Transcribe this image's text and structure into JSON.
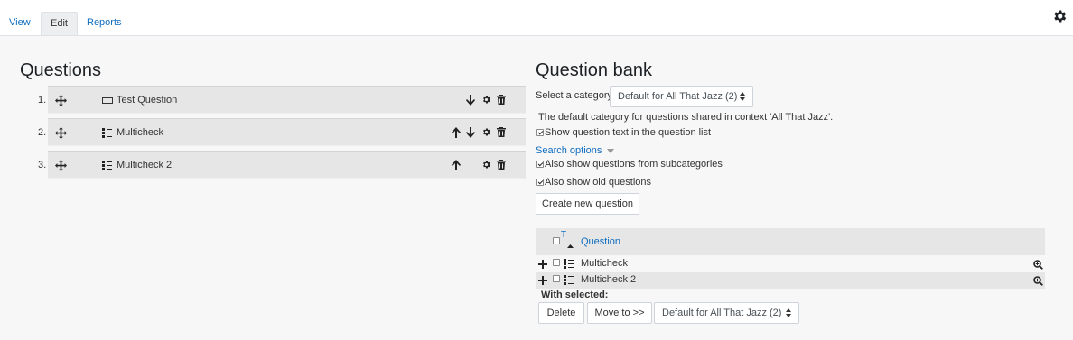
{
  "tabs": [
    {
      "label": "View"
    },
    {
      "label": "Edit"
    },
    {
      "label": "Reports"
    }
  ],
  "active_tab": "Edit",
  "questions": {
    "heading": "Questions",
    "items": [
      {
        "number": "1.",
        "name": "Test Question",
        "type_icon": "description-icon",
        "actions": [
          "arrow-down-icon",
          "gear-icon",
          "trash-icon"
        ]
      },
      {
        "number": "2.",
        "name": "Multicheck",
        "type_icon": "list-icon",
        "actions": [
          "arrow-up-icon",
          "arrow-down-icon",
          "gear-icon",
          "trash-icon"
        ]
      },
      {
        "number": "3.",
        "name": "Multicheck 2",
        "type_icon": "list-icon",
        "actions": [
          "arrow-up-icon",
          "gear-icon",
          "trash-icon"
        ]
      }
    ]
  },
  "bank": {
    "heading": "Question bank",
    "category_label": "Select a category:",
    "category_value": "Default for All That Jazz (2)",
    "category_info": "The default category for questions shared in context 'All That Jazz'.",
    "show_text_label": "Show question text in the question list",
    "show_text_checked": true,
    "search_options": "Search options",
    "subcategories_label": "Also show questions from subcategories",
    "subcategories_checked": true,
    "old_questions_label": "Also show old questions",
    "old_questions_checked": true,
    "create_button": "Create new question",
    "table": {
      "sort_t": "T",
      "column_question": "Question",
      "rows": [
        {
          "name": "Multicheck",
          "checked": false
        },
        {
          "name": "Multicheck 2",
          "checked": false
        }
      ]
    },
    "with_selected": "With selected:",
    "delete_button": "Delete",
    "move_button": "Move to >>",
    "move_category_value": "Default for All That Jazz (2)"
  },
  "colors": {
    "link": "#0f6cbf",
    "row_bg": "#e6e6e6",
    "page_bg": "#f7f7f7"
  }
}
